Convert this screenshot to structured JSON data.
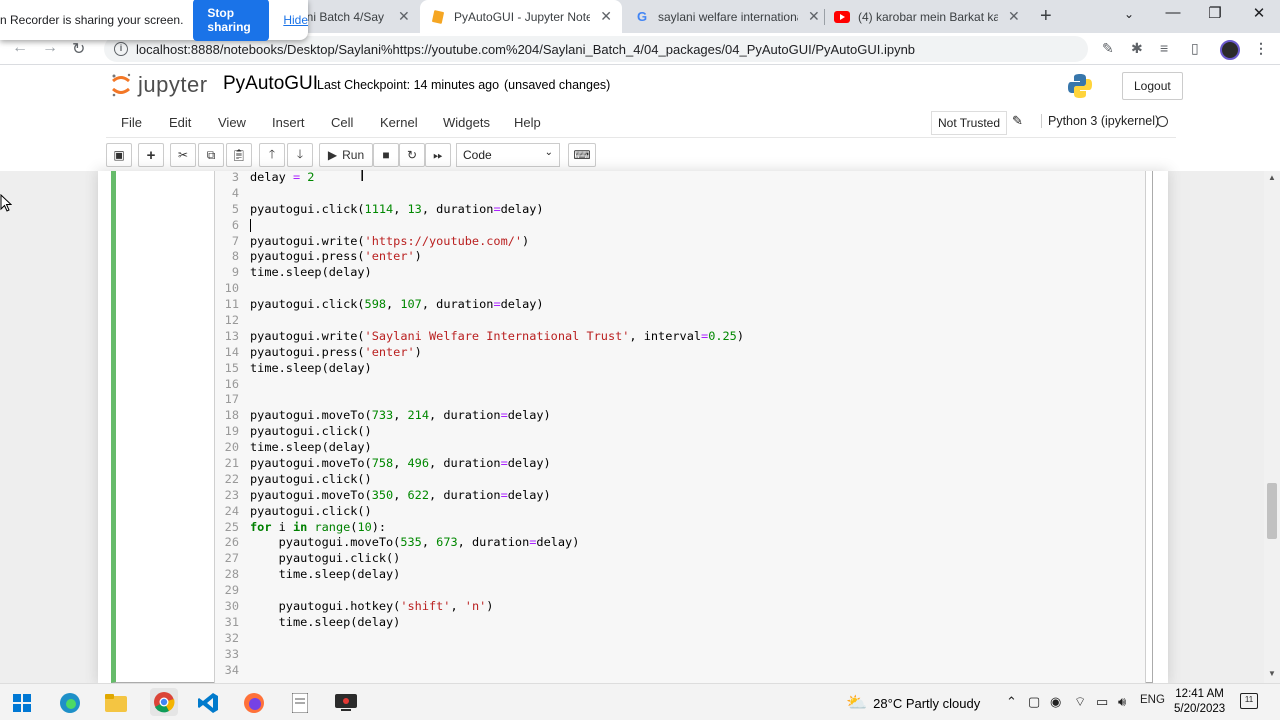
{
  "sharebar": {
    "message": "n Recorder is sharing your screen.",
    "stop_label": "Stop sharing",
    "hide_label": "Hide"
  },
  "tabs": [
    {
      "title": "ani Batch 4/Say",
      "icon": "jupyter-icon"
    },
    {
      "title": "PyAutoGUI - Jupyter Notebo",
      "icon": "jupyter-icon",
      "active": true
    },
    {
      "title": "saylani welfare international",
      "icon": "google-icon"
    },
    {
      "title": "(4) karobar mein Barkat ka w",
      "icon": "youtube-icon"
    }
  ],
  "address": {
    "url": "localhost:8888/notebooks/Desktop/Saylani%https://youtube.com%204/Saylani_Batch_4/04_packages/04_PyAutoGUI/PyAutoGUI.ipynb"
  },
  "header": {
    "logo_text": "jupyter",
    "notebook_title": "PyAutoGUI",
    "checkpoint": "Last Checkpoint: 14 minutes ago",
    "unsaved": "(unsaved changes)",
    "logout_label": "Logout"
  },
  "menu": {
    "items": [
      "File",
      "Edit",
      "View",
      "Insert",
      "Cell",
      "Kernel",
      "Widgets",
      "Help"
    ],
    "trust": "Not Trusted",
    "kernel": "Python 3 (ipykernel)"
  },
  "toolbar": {
    "run_label": "Run",
    "cell_type": "Code"
  },
  "code_lines": [
    {
      "n": "3",
      "text": "delay = 2"
    },
    {
      "n": "4",
      "text": ""
    },
    {
      "n": "5",
      "text": "pyautogui.click(1114, 13, duration=delay)"
    },
    {
      "n": "6",
      "text": ""
    },
    {
      "n": "7",
      "text": "pyautogui.write('https://youtube.com/')"
    },
    {
      "n": "8",
      "text": "pyautogui.press('enter')"
    },
    {
      "n": "9",
      "text": "time.sleep(delay)"
    },
    {
      "n": "10",
      "text": ""
    },
    {
      "n": "11",
      "text": "pyautogui.click(598, 107, duration=delay)"
    },
    {
      "n": "12",
      "text": ""
    },
    {
      "n": "13",
      "text": "pyautogui.write('Saylani Welfare International Trust', interval=0.25)"
    },
    {
      "n": "14",
      "text": "pyautogui.press('enter')"
    },
    {
      "n": "15",
      "text": "time.sleep(delay)"
    },
    {
      "n": "16",
      "text": ""
    },
    {
      "n": "17",
      "text": ""
    },
    {
      "n": "18",
      "text": "pyautogui.moveTo(733, 214, duration=delay)"
    },
    {
      "n": "19",
      "text": "pyautogui.click()"
    },
    {
      "n": "20",
      "text": "time.sleep(delay)"
    },
    {
      "n": "21",
      "text": "pyautogui.moveTo(758, 496, duration=delay)"
    },
    {
      "n": "22",
      "text": "pyautogui.click()"
    },
    {
      "n": "23",
      "text": "pyautogui.moveTo(350, 622, duration=delay)"
    },
    {
      "n": "24",
      "text": "pyautogui.click()"
    },
    {
      "n": "25",
      "text": "for i in range(10):"
    },
    {
      "n": "26",
      "text": "    pyautogui.moveTo(535, 673, duration=delay)"
    },
    {
      "n": "27",
      "text": "    pyautogui.click()"
    },
    {
      "n": "28",
      "text": "    time.sleep(delay)"
    },
    {
      "n": "29",
      "text": ""
    },
    {
      "n": "30",
      "text": "    pyautogui.hotkey('shift', 'n')"
    },
    {
      "n": "31",
      "text": "    time.sleep(delay)"
    },
    {
      "n": "32",
      "text": ""
    },
    {
      "n": "33",
      "text": ""
    },
    {
      "n": "34",
      "text": ""
    }
  ],
  "taskbar": {
    "weather": "28°C  Partly cloudy",
    "lang": "ENG",
    "time": "12:41 AM",
    "date": "5/20/2023",
    "notif_count": "11"
  },
  "colors": {
    "accent": "#1a73e8",
    "cell_edit": "#66bb6a"
  }
}
